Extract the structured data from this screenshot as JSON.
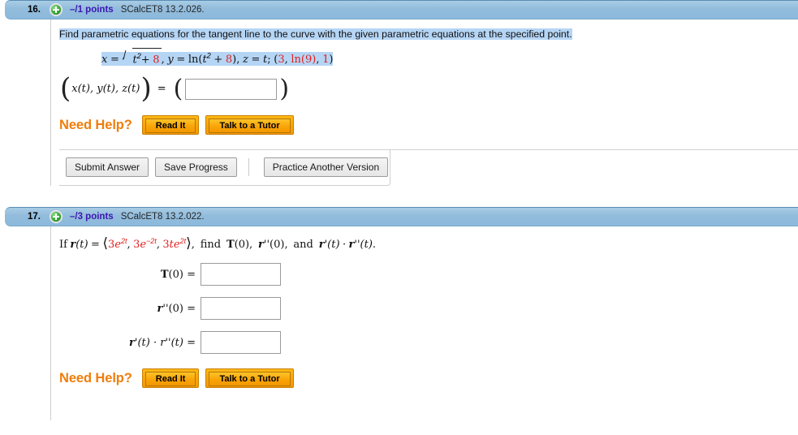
{
  "questions": [
    {
      "number": "16.",
      "points": "–/1 points",
      "code": "SCalcET8 13.2.026.",
      "prompt": "Find parametric equations for the tangent line to the curve with the given parametric equations at the specified point.",
      "equation": {
        "x_label": "x",
        "eq": "=",
        "radicand_base": "t",
        "radicand_exp": "2",
        "radicand_plus": "+",
        "radicand_const": "8",
        "comma1": ",",
        "y_label": "y",
        "ln_open": "ln(",
        "ln_base": "t",
        "ln_exp": "2",
        "ln_plus": "+",
        "ln_const": "8",
        "ln_close": ")",
        "comma2": ",",
        "z_label": "z",
        "z_value": "t",
        "semicolon": ";",
        "point_open": "(",
        "point_x": "3",
        "point_comma1": ",",
        "point_ln": "ln(9)",
        "point_comma2": ",",
        "point_z": "1",
        "point_close": ")"
      },
      "answer_label": "x(t), y(t), z(t)",
      "answer_equals": "=",
      "answer_value": "",
      "answer_placeholder": "",
      "need_help": {
        "label": "Need Help?",
        "read_it": "Read It",
        "talk_to_tutor": "Talk to a Tutor"
      },
      "actions": {
        "submit": "Submit Answer",
        "save": "Save Progress",
        "practice": "Practice Another Version"
      }
    },
    {
      "number": "17.",
      "points": "–/3 points",
      "code": "SCalcET8 13.2.022.",
      "prompt_parts": {
        "if": "If",
        "r_of_t": "r",
        "of_t": "(t)",
        "equals": "=",
        "open_angle": "⟨",
        "c1": "3",
        "c1e": "e",
        "c1exp": "2t",
        "comma1": ",",
        "c2": "3",
        "c2e": "e",
        "c2exp": "−2t",
        "comma2": ",",
        "c3": "3",
        "c3t": "te",
        "c3exp": "2t",
        "close_angle": "⟩",
        "comma3": ",",
        "find": "find",
        "t0": "T",
        "t0arg": "(0),",
        "rpp": "r",
        "rppmark": "''",
        "rpparg": "(0),",
        "and": "and",
        "rp": "r",
        "rpmark": "'",
        "rparg": "(t)",
        "dot": "·",
        "rpp2": "r",
        "rpp2mark": "''",
        "rpp2arg": "(t)."
      },
      "fields": [
        {
          "label_bold": "T",
          "label_rest": "(0) =",
          "value": ""
        },
        {
          "label_bold": "r",
          "label_rest": "''(0) =",
          "value": ""
        },
        {
          "label_bold": "r",
          "label_rest": "'(t) · r''(t) =",
          "value": ""
        }
      ],
      "need_help": {
        "label": "Need Help?",
        "read_it": "Read It",
        "talk_to_tutor": "Talk to a Tutor"
      }
    }
  ],
  "colors": {
    "header_blue": "#8cb9dc",
    "points_purple": "#3d17b0",
    "constant_red": "#e02020",
    "help_orange": "#f07d0a",
    "highlight_blue": "#b5d5f5"
  }
}
